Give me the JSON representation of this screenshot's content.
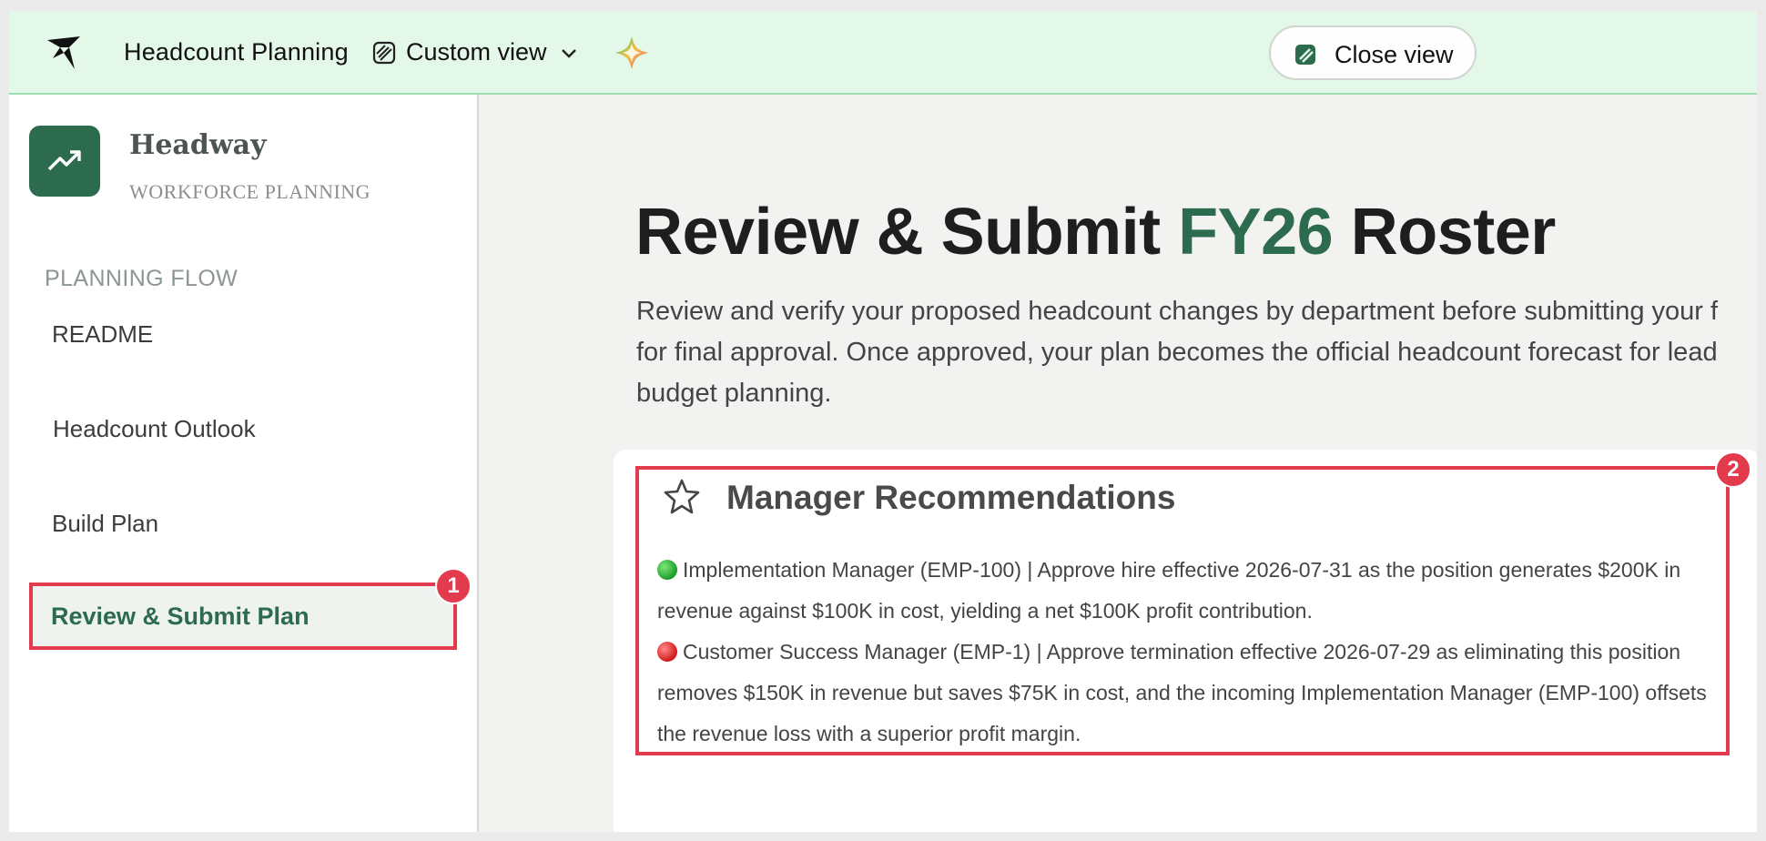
{
  "topbar": {
    "app_title": "Headcount Planning",
    "view_label": "Custom view",
    "close_label": "Close view"
  },
  "sidebar": {
    "brand_name": "Headway",
    "brand_sub": "WORKFORCE PLANNING",
    "section_label": "PLANNING FLOW",
    "items": [
      {
        "label": "README"
      },
      {
        "label": "Headcount Outlook"
      },
      {
        "label": "Build Plan"
      },
      {
        "label": "Review & Submit Plan"
      }
    ],
    "active_badge": "1"
  },
  "main": {
    "title_pre": "Review & Submit ",
    "title_accent": "FY26",
    "title_post": " Roster",
    "description_lines": [
      "Review and verify your proposed headcount changes by department before submitting your f",
      "for final approval. Once approved, your plan becomes the official headcount forecast for lead",
      "budget planning."
    ],
    "recommendations": {
      "title": "Manager Recommendations",
      "badge": "2",
      "items": [
        {
          "status_icon": "green-circle-icon",
          "text": "Implementation Manager (EMP-100) | Approve hire effective 2026-07-31 as the position generates $200K in revenue against $100K in cost, yielding a net $100K profit contribution."
        },
        {
          "status_icon": "red-circle-icon",
          "text": "Customer Success Manager (EMP-1) | Approve termination effective 2026-07-29 as eliminating this position removes $150K in revenue but saves $75K in cost, and the incoming Implementation Manager (EMP-100) offsets the revenue loss with a superior profit margin."
        }
      ]
    }
  },
  "colors": {
    "brand_green": "#2d6b4f",
    "topbar_bg": "#e3f8e8",
    "highlight_red": "#e23b4d"
  }
}
